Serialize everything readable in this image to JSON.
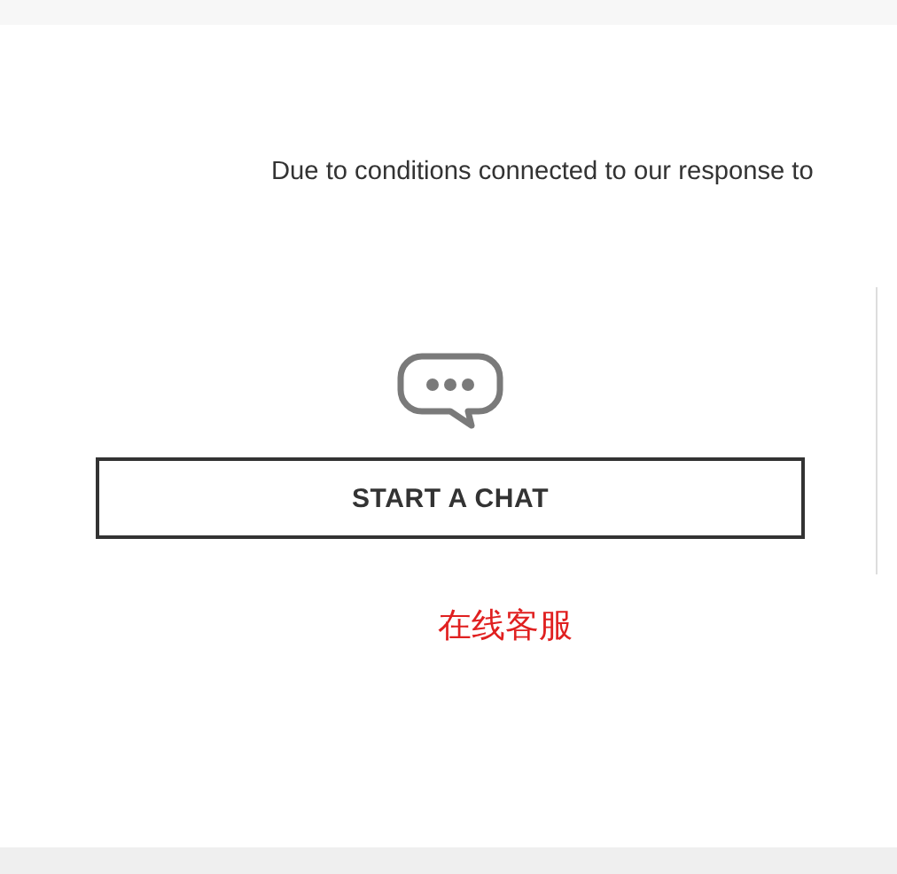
{
  "notice": "Due to conditions connected to our response to",
  "chat": {
    "button": "START A CHAT"
  },
  "caption": "在线客服"
}
